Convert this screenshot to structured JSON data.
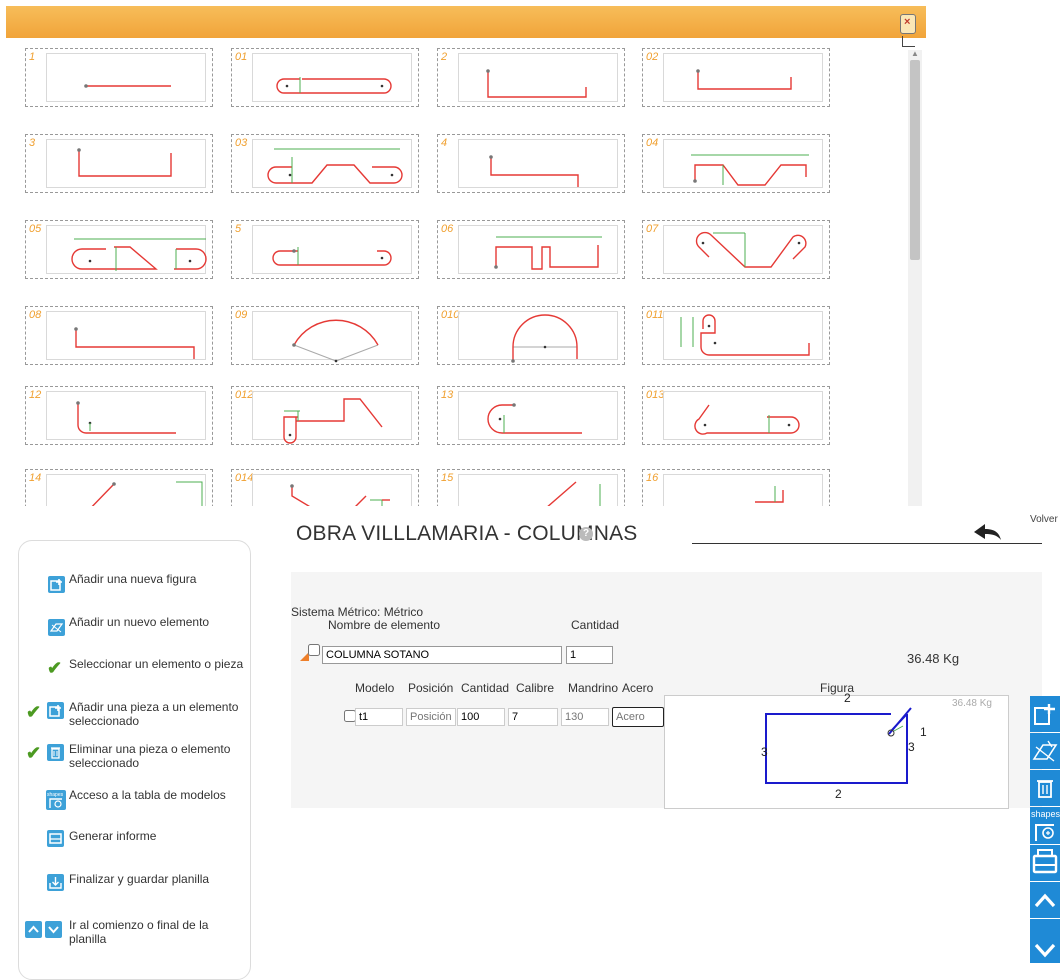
{
  "popup": {
    "close_label": "×",
    "tiles": [
      "1",
      "01",
      "2",
      "02",
      "3",
      "03",
      "4",
      "04",
      "05",
      "5",
      "06",
      "07",
      "08",
      "09",
      "010",
      "011",
      "12",
      "012",
      "13",
      "013",
      "14",
      "014",
      "15",
      "16"
    ]
  },
  "header": {
    "title": "OBRA VILLLAMARIA - COLUMNAS",
    "help": "?",
    "back_label": "Volver"
  },
  "legend": {
    "items": [
      {
        "label": "Añadir una nueva figura",
        "icon": "add-figure-icon"
      },
      {
        "label": "Añadir un nuevo elemento",
        "icon": "add-element-icon"
      },
      {
        "label": "Seleccionar un elemento o pieza",
        "icon": "check-icon"
      },
      {
        "label": "Añadir una pieza a un elemento",
        "label2": "seleccionado",
        "icon": "add-piece-icon"
      },
      {
        "label": "Eliminar una pieza o elemento",
        "label2": "seleccionado",
        "icon": "trash-icon"
      },
      {
        "label": "Acceso a la tabla de modelos",
        "icon": "shapes-icon",
        "icon_text": "shapes"
      },
      {
        "label": "Generar informe",
        "icon": "print-icon"
      },
      {
        "label": "Finalizar y guardar planilla",
        "icon": "save-icon"
      },
      {
        "label": "Ir al comienzo o final de la",
        "label2": "planilla",
        "icon": "chevron-up-down-icon"
      }
    ]
  },
  "form": {
    "sistema": "Sistema Métrico: Métrico",
    "element_name_header": "Nombre de elemento",
    "cantidad_header": "Cantidad",
    "element_name": "COLUMNA SOTANO",
    "element_qty": "1",
    "weight": "36.48 Kg",
    "columns": [
      "Modelo",
      "Posición",
      "Cantidad",
      "Calibre",
      "Mandrino",
      "Acero",
      "Figura"
    ],
    "row": {
      "modelo": "t1",
      "posicion_placeholder": "Posición",
      "cantidad": "100",
      "calibre": "7",
      "mandrino_placeholder": "130",
      "acero_placeholder": "Acero"
    },
    "figure": {
      "weight": "36.48 Kg",
      "labels": [
        "2",
        "1",
        "3",
        "3",
        "2"
      ]
    }
  },
  "toolbar": {
    "shapes_text": "shapes",
    "items": [
      "add-figure-icon",
      "add-element-icon",
      "trash-icon",
      "shapes-icon",
      "print-icon",
      "chevron-up-icon",
      "chevron-down-icon"
    ]
  },
  "colors": {
    "accent": "#f1a43a",
    "tool": "#1f8ad6",
    "shape": "#e53935",
    "dimension": "#4caf50",
    "figure_line": "#1a1acc"
  }
}
